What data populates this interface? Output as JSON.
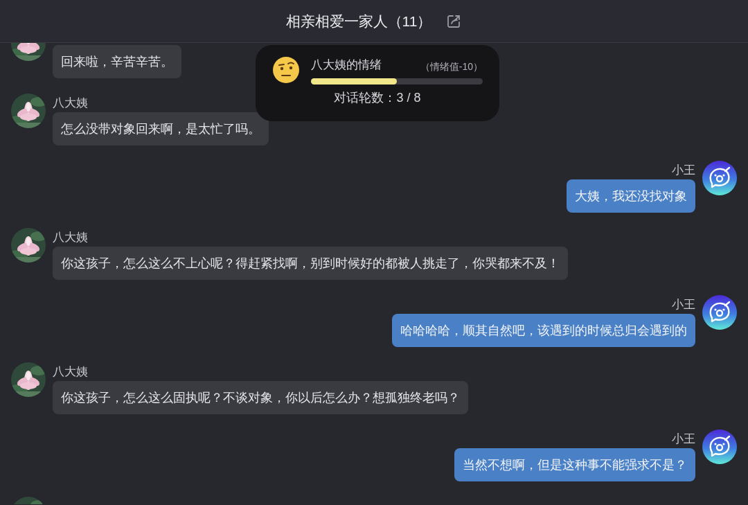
{
  "header": {
    "title": "相亲相爱一家人（11）"
  },
  "emotion_card": {
    "title": "八大姨的情绪",
    "value": "（情绪值-10）",
    "level": 0.5,
    "rounds": "对话轮数：3 / 8"
  },
  "messages": [
    {
      "kind": "incoming",
      "text": "回来啦，辛苦辛苦。"
    },
    {
      "kind": "incoming",
      "name": "八大姨",
      "text": "怎么没带对象回来啊，是太忙了吗。"
    },
    {
      "kind": "outgoing",
      "name": "小王",
      "text": "大姨，我还没找对象"
    },
    {
      "kind": "incoming",
      "name": "八大姨",
      "text": "你这孩子，怎么这么不上心呢？得赶紧找啊，别到时候好的都被人挑走了，你哭都来不及！"
    },
    {
      "kind": "outgoing",
      "name": "小王",
      "text": "哈哈哈哈，顺其自然吧，该遇到的时候总归会遇到的"
    },
    {
      "kind": "incoming",
      "name": "八大姨",
      "text": "你这孩子，怎么这么固执呢？不谈对象，你以后怎么办？想孤独终老吗？"
    },
    {
      "kind": "outgoing",
      "name": "小王",
      "text": "当然不想啊，但是这种事不能强求不是？"
    },
    {
      "kind": "incoming"
    }
  ]
}
